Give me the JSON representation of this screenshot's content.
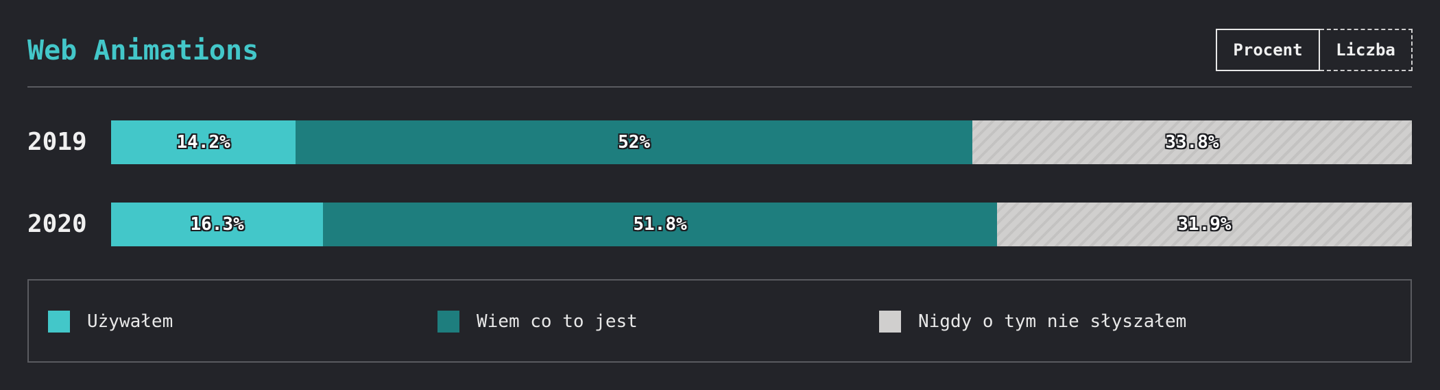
{
  "title": "Web Animations",
  "toggle": {
    "options": [
      "Procent",
      "Liczba"
    ],
    "selected": "Procent"
  },
  "colors": {
    "background": "#232429",
    "accent": "#43c7c9",
    "used": "#43c7c9",
    "known": "#1e7e7e",
    "never": "#d0cfce"
  },
  "chart_data": {
    "type": "bar",
    "orientation": "horizontal",
    "stacked": true,
    "normalized": true,
    "title": "Web Animations",
    "categories": [
      "2019",
      "2020"
    ],
    "series": [
      {
        "name": "Używałem",
        "values": [
          14.2,
          16.3
        ],
        "labels": [
          "14.2%",
          "16.3%"
        ],
        "color": "#43c7c9",
        "pattern": "solid"
      },
      {
        "name": "Wiem co to jest",
        "values": [
          52.0,
          51.8
        ],
        "labels": [
          "52%",
          "51.8%"
        ],
        "color": "#1e7e7e",
        "pattern": "solid"
      },
      {
        "name": "Nigdy o tym nie słyszałem",
        "values": [
          33.8,
          31.9
        ],
        "labels": [
          "33.8%",
          "31.9%"
        ],
        "color": "#d0cfce",
        "pattern": "hatched"
      }
    ],
    "legend_position": "bottom",
    "grid": false
  }
}
